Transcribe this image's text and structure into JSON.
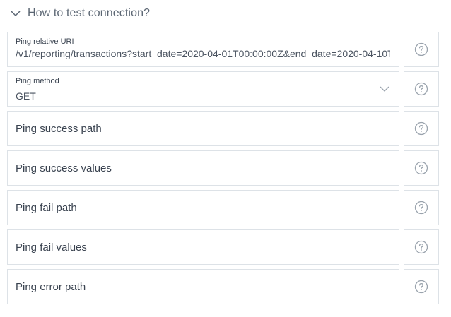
{
  "section": {
    "title": "How to test connection?",
    "expand_icon": "chevron-down-icon"
  },
  "fields": {
    "ping_uri": {
      "label": "Ping relative URI",
      "value": "/v1/reporting/transactions?start_date=2020-04-01T00:00:00Z&end_date=2020-04-10T"
    },
    "ping_method": {
      "label": "Ping method",
      "value": "GET",
      "dropdown_icon": "chevron-down-icon"
    },
    "ping_success_path": {
      "placeholder": "Ping success path"
    },
    "ping_success_values": {
      "placeholder": "Ping success values"
    },
    "ping_fail_path": {
      "placeholder": "Ping fail path"
    },
    "ping_fail_values": {
      "placeholder": "Ping fail values"
    },
    "ping_error_path": {
      "placeholder": "Ping error path"
    }
  },
  "help_icon": "question-circle-icon",
  "colors": {
    "border": "#dde2e7",
    "text": "#3a4350",
    "icon": "#9aa3ad"
  }
}
